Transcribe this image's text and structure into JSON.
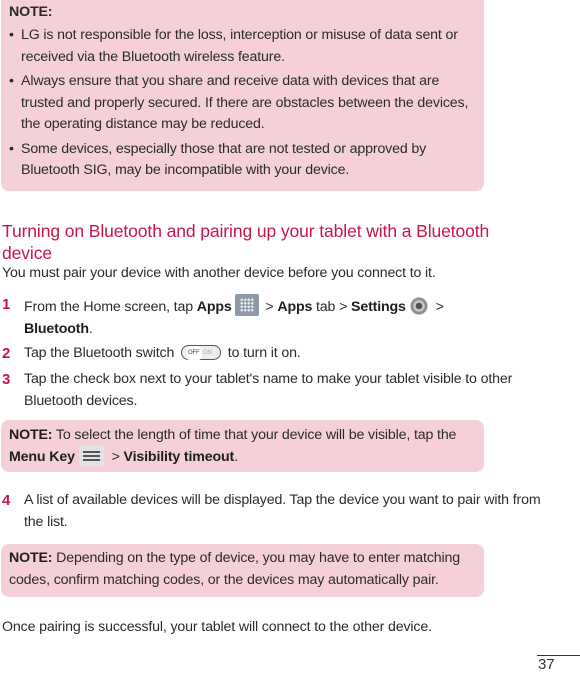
{
  "note_top": {
    "title": "NOTE:",
    "bullets": [
      "LG is not responsible for the loss, interception or misuse of data sent or received via the Bluetooth wireless feature.",
      "Always ensure that you share and receive data with devices that are trusted and properly secured. If there are obstacles between the devices, the operating distance may be reduced.",
      "Some devices, especially those that are not tested or approved by Bluetooth SIG, may be incompatible with your device."
    ]
  },
  "section": {
    "heading": "Turning on Bluetooth and pairing up your tablet with a Bluetooth device",
    "intro": "You must pair your device with another device before you connect to it.",
    "steps": [
      {
        "num": "1",
        "parts": {
          "a": "From the Home screen, tap ",
          "apps": "Apps",
          "b": " > ",
          "apps_tab": "Apps",
          "c": " tab > ",
          "settings": "Settings",
          "d": " > ",
          "bluetooth": "Bluetooth",
          "e": "."
        }
      },
      {
        "num": "2",
        "parts": {
          "a": "Tap the Bluetooth switch ",
          "b": " to turn it on."
        },
        "switch": {
          "off": "OFF",
          "on": "ON"
        }
      },
      {
        "num": "3",
        "text": "Tap the check box next to your tablet's name to make your tablet visible to other Bluetooth devices."
      },
      {
        "num": "4",
        "text": "A list of available devices will be displayed. Tap the device you want to pair with from the list."
      }
    ],
    "note_visibility": {
      "label": "NOTE:",
      "a": " To select the length of time that your device will be visible, tap the ",
      "menu_key": "Menu Key",
      "b": " > ",
      "visibility_timeout": "Visibility timeout",
      "c": "."
    },
    "note_pairing": {
      "label": "NOTE:",
      "text": " Depending on the type of device, you may have to enter matching codes, confirm matching codes, or the devices may automatically pair."
    },
    "closing": "Once pairing is successful, your tablet will connect to the other device."
  },
  "page_number": "37",
  "colors": {
    "accent": "#c8154a",
    "note_bg": "#f5d0d8"
  },
  "icons": [
    "apps-grid-icon",
    "settings-gear-icon",
    "bluetooth-switch-icon",
    "menu-key-icon"
  ]
}
